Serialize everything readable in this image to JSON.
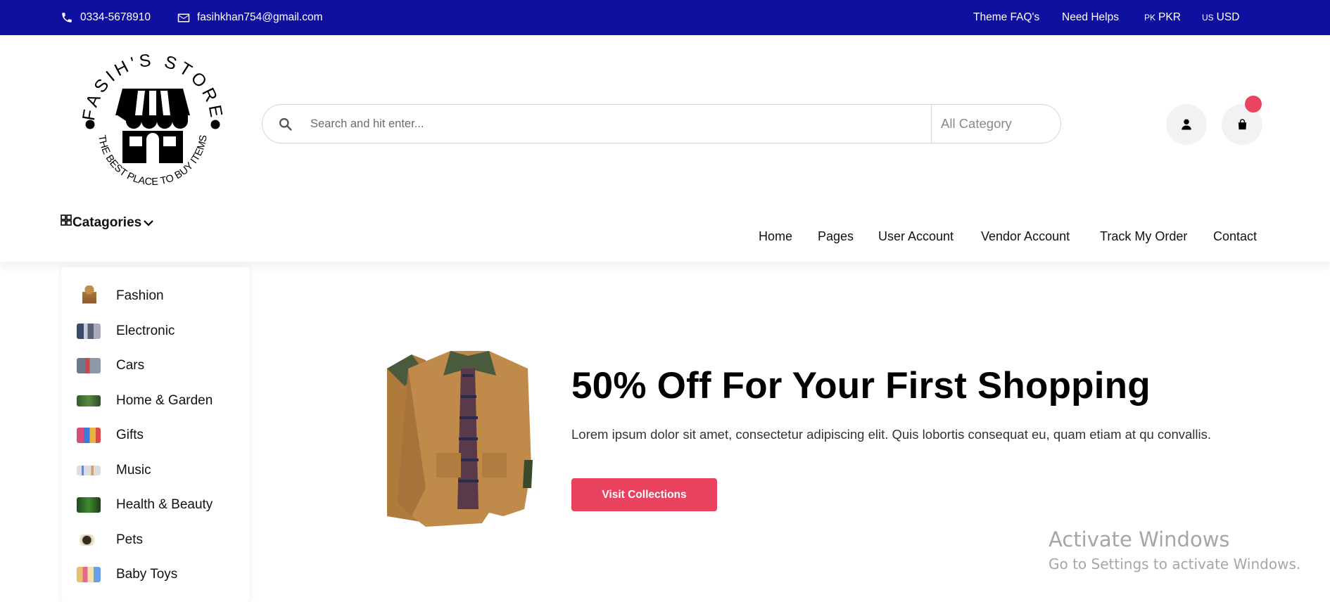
{
  "topbar": {
    "phone": "0334-5678910",
    "email": "fasihkhan754@gmail.com",
    "links": [
      "Theme FAQ's",
      "Need Helps"
    ],
    "currency_pk_code": "PK",
    "currency_pk": "PKR",
    "currency_us_code": "US",
    "currency_us": "USD",
    "bg_color": "#0f0fa0"
  },
  "logo": {
    "brand": "FASIH'S STORE",
    "tagline": "THE BEST PLACE TO BUY ITEMS"
  },
  "search": {
    "placeholder": "Search and hit enter...",
    "category": "All Category"
  },
  "cart": {
    "badge_color": "#e94560"
  },
  "categories_toggle": "Catagories",
  "nav": [
    "Home",
    "Pages",
    "User Account",
    "Vendor Account",
    "Track My Order",
    "Contact"
  ],
  "sidebar": {
    "items": [
      {
        "label": "Fashion",
        "icon": "fashion-thumb"
      },
      {
        "label": "Electronic",
        "icon": "electronic-thumb"
      },
      {
        "label": "Cars",
        "icon": "cars-thumb"
      },
      {
        "label": "Home & Garden",
        "icon": "garden-thumb"
      },
      {
        "label": "Gifts",
        "icon": "gifts-thumb"
      },
      {
        "label": "Music",
        "icon": "music-thumb"
      },
      {
        "label": "Health & Beauty",
        "icon": "health-thumb"
      },
      {
        "label": "Pets",
        "icon": "pets-thumb"
      },
      {
        "label": "Baby Toys",
        "icon": "toys-thumb"
      }
    ]
  },
  "hero": {
    "title": "50% Off For Your First Shopping",
    "text": "Lorem ipsum dolor sit amet, consectetur adipiscing elit. Quis lobortis consequat eu, quam etiam at qu convallis.",
    "button": "Visit Collections",
    "accent": "#e8425f"
  },
  "watermark": {
    "line1": "Activate Windows",
    "line2": "Go to Settings to activate Windows."
  }
}
